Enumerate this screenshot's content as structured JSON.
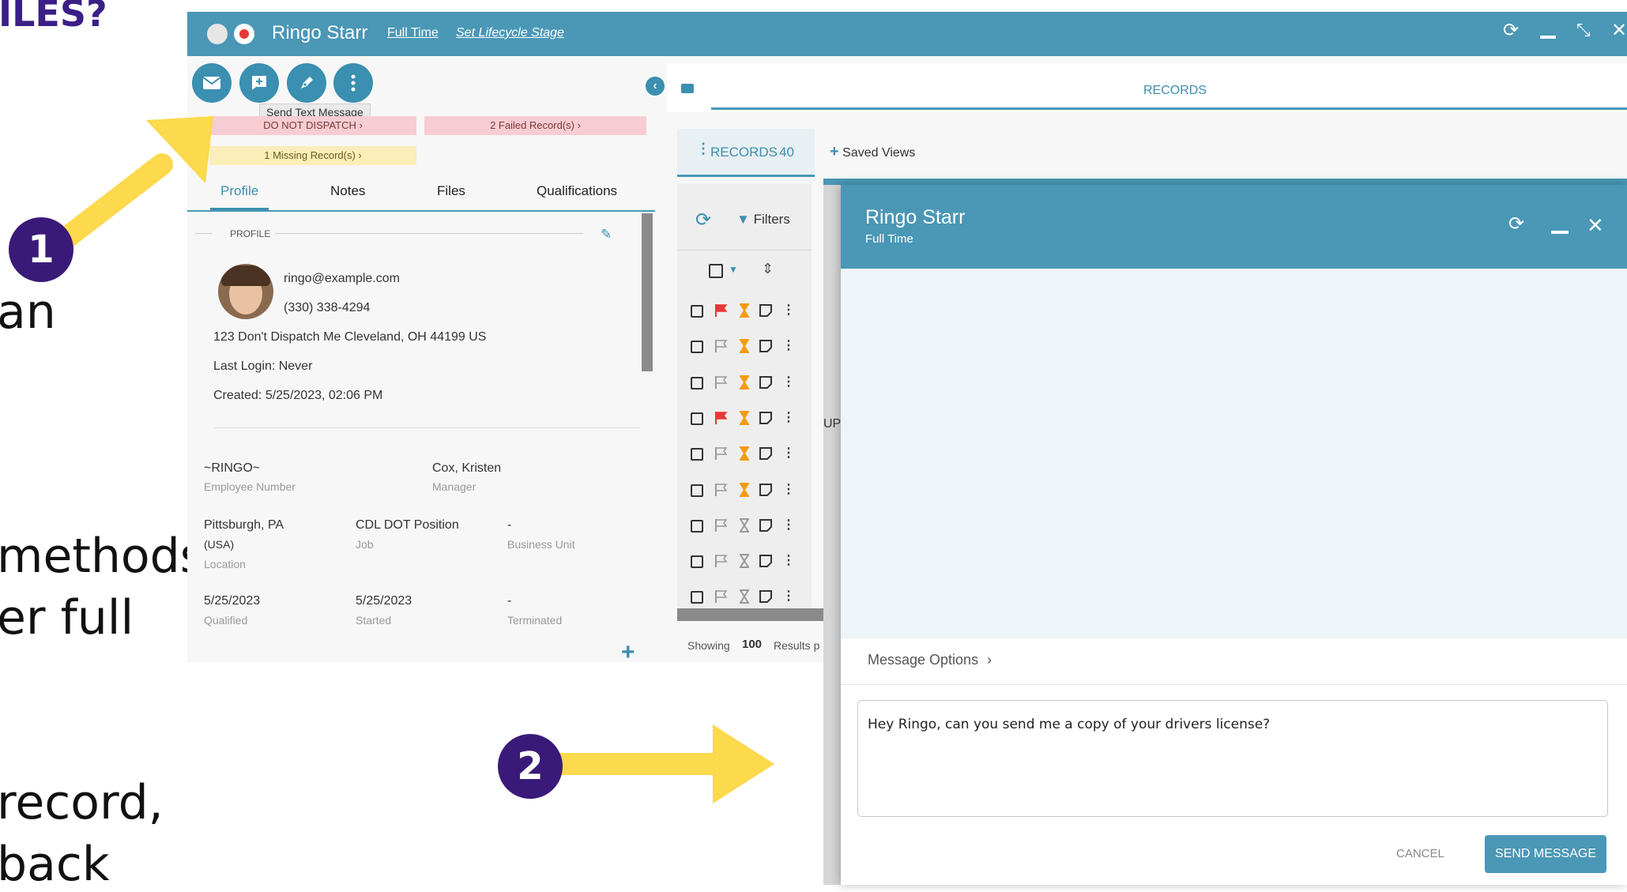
{
  "slide": {
    "heading_fragment": "ILES?",
    "text_lines": [
      "an",
      "methods",
      "er full",
      "record,",
      "back"
    ],
    "step1": "1",
    "step2": "2"
  },
  "window": {
    "name": "Ringo Starr",
    "link_full_time": "Full Time",
    "link_lifecycle": "Set Lifecycle Stage"
  },
  "actions": {
    "tooltip": "Send Text Message"
  },
  "alerts": {
    "dnd": "DO NOT DISPATCH ›",
    "failed": "2 Failed Record(s) ›",
    "missing": "1 Missing Record(s) ›"
  },
  "tabs": [
    "Profile",
    "Notes",
    "Files",
    "Qualifications"
  ],
  "profile": {
    "section": "PROFILE",
    "email": "ringo@example.com",
    "phone": "(330) 338-4294",
    "address": "123 Don't Dispatch Me Cleveland, OH 44199 US",
    "last_login": "Last Login: Never",
    "created": "Created: 5/25/2023, 02:06 PM",
    "employee_number": "~RINGO~",
    "employee_number_label": "Employee Number",
    "manager": "Cox, Kristen",
    "manager_label": "Manager",
    "location_1": "Pittsburgh, PA",
    "location_2": "(USA)",
    "location_label": "Location",
    "job": "CDL DOT Position",
    "job_label": "Job",
    "business_unit": "-",
    "business_unit_label": "Business Unit",
    "qualified": "5/25/2023",
    "qualified_label": "Qualified",
    "started": "5/25/2023",
    "started_label": "Started",
    "terminated": "-",
    "terminated_label": "Terminated"
  },
  "records": {
    "header": "RECORDS",
    "tab_label": "RECORDS",
    "count": "40",
    "saved_views": "Saved Views",
    "filters": "Filters",
    "showing": "Showing",
    "per_page": "100",
    "results": "Results p",
    "partial_text": "UPS",
    "rows": [
      {
        "flag": "red",
        "hourglass": "orange"
      },
      {
        "flag": "none",
        "hourglass": "orange"
      },
      {
        "flag": "none",
        "hourglass": "orange"
      },
      {
        "flag": "red",
        "hourglass": "orange"
      },
      {
        "flag": "none",
        "hourglass": "orange"
      },
      {
        "flag": "none",
        "hourglass": "orange"
      },
      {
        "flag": "none",
        "hourglass": "gray"
      },
      {
        "flag": "none",
        "hourglass": "gray"
      },
      {
        "flag": "none",
        "hourglass": "gray"
      }
    ]
  },
  "dialog": {
    "name": "Ringo Starr",
    "subtitle": "Full Time",
    "message_options": "Message Options",
    "message": "Hey Ringo, can you send me a copy of your drivers license?",
    "cancel": "CANCEL",
    "send": "SEND MESSAGE"
  },
  "colors": {
    "brand": "#4a97b6",
    "accent": "#3b8fb0",
    "badge": "#3a1a78",
    "arrow": "#fcd94d",
    "flag_red": "#e53935",
    "hourglass_orange": "#f39c12"
  }
}
